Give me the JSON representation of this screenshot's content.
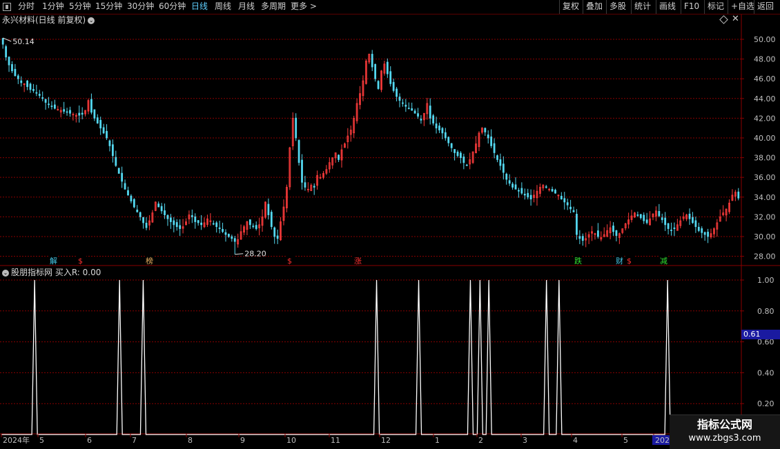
{
  "toolbar": {
    "left_items": [
      "分时",
      "1分钟",
      "5分钟",
      "15分钟",
      "30分钟",
      "60分钟",
      "日线",
      "周线",
      "月线",
      "多周期",
      "更多 >"
    ],
    "active_index": 6,
    "right_items": [
      "复权",
      "叠加",
      "多股",
      "统计",
      "画线",
      "F10",
      "标记",
      "+自选",
      "返回"
    ]
  },
  "main_chart": {
    "title": "永兴材料(日线 前复权)",
    "price_axis": [
      "50.00",
      "48.00",
      "46.00",
      "44.00",
      "42.00",
      "40.00",
      "38.00",
      "36.00",
      "34.00",
      "32.00",
      "30.00",
      "28.00"
    ],
    "high_label": "50.14",
    "low_label": "28.20",
    "markers": [
      {
        "text": "解",
        "color": "#44c8e8"
      },
      {
        "text": "$",
        "color": "#ff3030"
      },
      {
        "text": "榜",
        "color": "#e8b060"
      },
      {
        "text": "$",
        "color": "#ff3030"
      },
      {
        "text": "涨",
        "color": "#ff3030"
      },
      {
        "text": "跌",
        "color": "#30e030"
      },
      {
        "text": "财",
        "color": "#44c8e8"
      },
      {
        "text": "$",
        "color": "#ff3030"
      },
      {
        "text": "减",
        "color": "#30e030"
      }
    ]
  },
  "indicator": {
    "title": "股朋指标网  买入R: 0.00",
    "axis": [
      "1.00",
      "0.80",
      "0.60",
      "0.40",
      "0.20"
    ],
    "current_value": "0.61"
  },
  "time_axis": [
    "2024年",
    "5",
    "6",
    "7",
    "8",
    "9",
    "10",
    "11",
    "12",
    "1",
    "2",
    "3",
    "4",
    "5",
    "2025"
  ],
  "watermark": {
    "title": "指标公式网",
    "url": "www.zbgs3.com"
  },
  "colors": {
    "up": "#ff3c3c",
    "down": "#54d8f0",
    "grid": "#8a0000",
    "signal": "#ffffff",
    "axis": "#8a0000"
  },
  "chart_data": {
    "type": "candlestick",
    "price_range": [
      27.2,
      51.4
    ],
    "closes": [
      49.5,
      48.2,
      47.4,
      46.8,
      46.3,
      46.0,
      45.6,
      45.5,
      45.2,
      44.9,
      44.8,
      44.6,
      44.3,
      44.0,
      43.6,
      43.4,
      43.2,
      43.0,
      42.9,
      42.8,
      42.7,
      42.6,
      42.5,
      42.4,
      42.3,
      42.3,
      42.4,
      42.8,
      43.8,
      42.6,
      42.0,
      41.5,
      41.0,
      40.5,
      40.0,
      39.2,
      38.2,
      37.2,
      36.4,
      35.6,
      34.8,
      34.2,
      33.6,
      33.0,
      32.5,
      32.0,
      31.4,
      30.9,
      31.6,
      32.4,
      33.5,
      33.0,
      32.6,
      32.2,
      31.8,
      31.5,
      31.2,
      31.0,
      30.8,
      31.0,
      31.5,
      32.2,
      32.0,
      31.5,
      31.4,
      31.2,
      31.4,
      31.8,
      31.6,
      31.3,
      31.0,
      30.8,
      30.5,
      30.2,
      30.0,
      29.8,
      29.5,
      29.7,
      30.5,
      31.0,
      31.5,
      31.2,
      31.0,
      30.8,
      31.2,
      32.0,
      33.5,
      32.2,
      31.0,
      30.0,
      29.8,
      31.5,
      33.0,
      35.0,
      39.0,
      42.0,
      40.0,
      37.5,
      35.5,
      35.0,
      34.8,
      35.2,
      35.0,
      36.2,
      36.0,
      36.4,
      36.8,
      37.5,
      38.0,
      38.5,
      37.8,
      38.8,
      39.4,
      40.2,
      40.8,
      42.0,
      43.5,
      44.5,
      45.8,
      47.8,
      48.5,
      47.2,
      46.0,
      45.0,
      46.8,
      47.5,
      46.5,
      45.5,
      44.8,
      44.2,
      43.8,
      43.5,
      43.2,
      43.0,
      42.8,
      42.5,
      42.2,
      41.8,
      42.5,
      43.5,
      42.0,
      41.5,
      41.0,
      40.8,
      40.5,
      40.0,
      39.5,
      39.0,
      38.5,
      38.2,
      38.0,
      37.5,
      37.2,
      37.8,
      38.6,
      39.4,
      40.5,
      41.0,
      40.6,
      40.0,
      39.2,
      38.5,
      37.8,
      37.2,
      36.5,
      35.8,
      35.4,
      35.0,
      34.8,
      34.6,
      34.4,
      34.2,
      34.0,
      33.8,
      34.2,
      34.6,
      35.0,
      35.2,
      35.0,
      34.8,
      34.6,
      34.4,
      34.2,
      33.8,
      33.5,
      33.2,
      32.8,
      32.5,
      30.2,
      29.8,
      29.6,
      29.8,
      30.2,
      30.5,
      30.3,
      30.0,
      29.9,
      30.2,
      30.6,
      30.9,
      30.5,
      30.1,
      30.3,
      30.8,
      31.3,
      31.7,
      32.1,
      32.4,
      32.2,
      31.9,
      31.6,
      31.4,
      31.8,
      32.3,
      32.6,
      32.1,
      31.7,
      31.2,
      30.8,
      30.6,
      30.8,
      31.2,
      31.6,
      32.0,
      32.2,
      31.8,
      31.4,
      31.0,
      30.6,
      30.4,
      30.2,
      30.0,
      30.3,
      30.8,
      31.4,
      32.0,
      32.4,
      32.8,
      33.4,
      34.2,
      34.5,
      33.9
    ],
    "highs_special": {
      "max": 50.14,
      "min": 28.2
    },
    "signal_positions": [
      0.045,
      0.16,
      0.192,
      0.508,
      0.565,
      0.635,
      0.648,
      0.66,
      0.738,
      0.755,
      0.902
    ]
  }
}
